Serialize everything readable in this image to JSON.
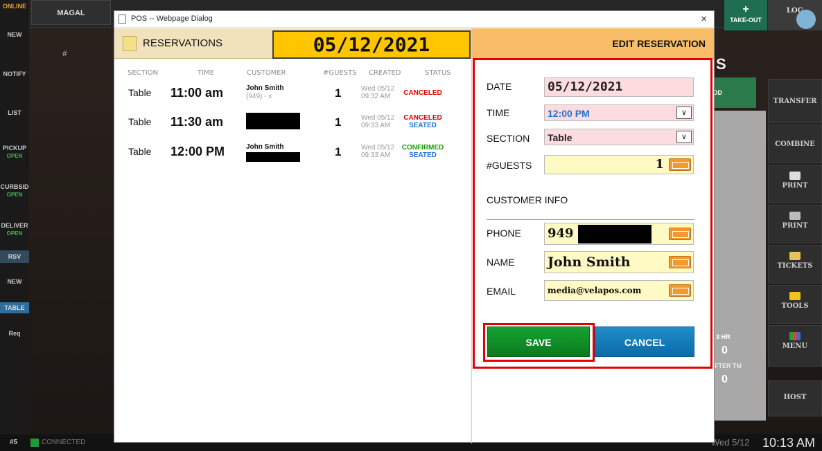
{
  "background": {
    "left_nav": [
      {
        "label": "ONLINE"
      },
      {
        "label": "NEW"
      },
      {
        "label": "NOTIFY"
      },
      {
        "label": "LIST"
      },
      {
        "label": "PICKUP",
        "sub": "OPEN"
      },
      {
        "label": "CURBSID",
        "sub": "OPEN"
      },
      {
        "label": "DELIVER",
        "sub": "OPEN"
      },
      {
        "label": "RSV"
      },
      {
        "label": "NEW"
      },
      {
        "label": "TABLE"
      },
      {
        "label": "Req"
      }
    ],
    "magal_label": "MAGAL",
    "hash_label": "#",
    "takeout_label": "TAKE-OUT",
    "logout_label": "LOG",
    "add_label": "DD",
    "right_buttons": [
      "TRANSFER",
      "COMBINE",
      "PRINT",
      "PRINT",
      "TICKETS",
      "TOOLS",
      "MENU",
      "HOST"
    ],
    "stats": {
      "three_hr_label": "3 HR",
      "three_hr_value": "0",
      "after_tm_label": "AFTER TM",
      "after_tm_value": "0"
    },
    "status": {
      "station": "#5",
      "connection": "CONNECTED",
      "date": "Wed 5/12",
      "time": "10:13 AM"
    }
  },
  "dialog": {
    "title": "POS -- Webpage Dialog",
    "close": "×",
    "reservations_label": "RESERVATIONS",
    "selected_date": "05/12/2021",
    "edit_label": "EDIT RESERVATION",
    "columns": [
      "SECTION",
      "TIME",
      "CUSTOMER",
      "#GUESTS",
      "CREATED",
      "STATUS"
    ],
    "rows": [
      {
        "section": "Table",
        "time": "11:00 am",
        "customer": "John Smith",
        "phone": "(949) - x",
        "guests": "1",
        "created_day": "Wed 05/12",
        "created_time": "09:32 AM",
        "status1": "CANCELED",
        "status2": ""
      },
      {
        "section": "Table",
        "time": "11:30 am",
        "customer": "",
        "phone": "",
        "guests": "1",
        "created_day": "Wed 05/12",
        "created_time": "09:33 AM",
        "status1": "CANCELED",
        "status2": "SEATED"
      },
      {
        "section": "Table",
        "time": "12:00 PM",
        "customer": "John Smith",
        "phone": "",
        "guests": "1",
        "created_day": "Wed 05/12",
        "created_time": "09:33 AM",
        "status1": "CONFIRMED",
        "status2": "SEATED"
      }
    ],
    "form": {
      "date_label": "DATE",
      "date_value": "05/12/2021",
      "time_label": "TIME",
      "time_value": "12:00 PM",
      "section_label": "SECTION",
      "section_value": "Table",
      "guests_label": "#GUESTS",
      "guests_value": "1",
      "customer_info_label": "CUSTOMER INFO",
      "phone_label": "PHONE",
      "phone_value": "949",
      "name_label": "NAME",
      "name_value": "John Smith",
      "email_label": "EMAIL",
      "email_value": "media@velapos.com",
      "save_label": "SAVE",
      "cancel_label": "CANCEL"
    }
  },
  "colors": {
    "canceled": "#e00000",
    "confirmed": "#1aa000",
    "seated": "#1e73d6",
    "highlight": "#e50000"
  }
}
